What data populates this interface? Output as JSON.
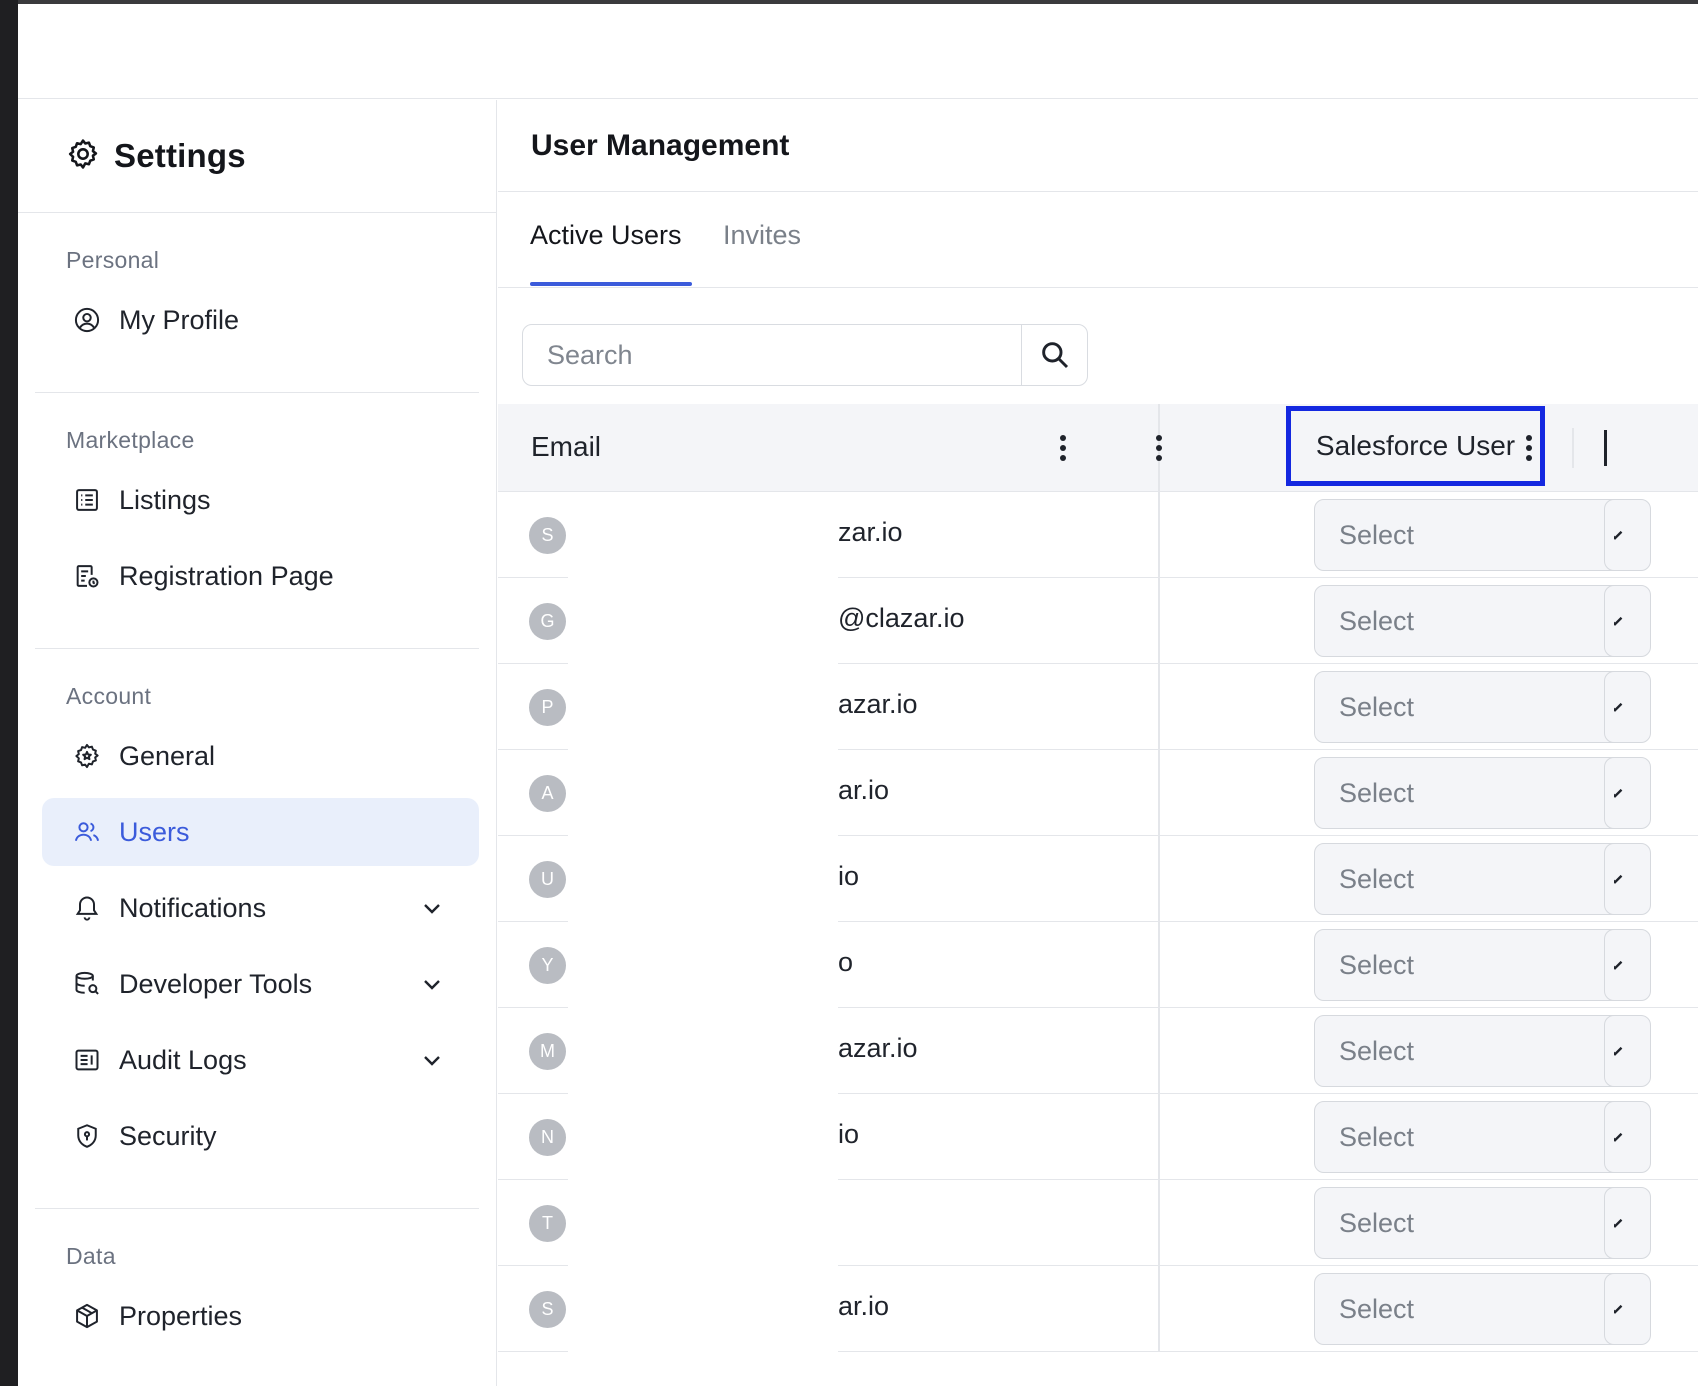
{
  "sidebar": {
    "title": "Settings",
    "sections": [
      {
        "label": "Personal",
        "items": [
          {
            "label": "My Profile",
            "icon": "user-circle-icon"
          }
        ]
      },
      {
        "label": "Marketplace",
        "items": [
          {
            "label": "Listings",
            "icon": "list-icon"
          },
          {
            "label": "Registration Page",
            "icon": "form-icon"
          }
        ]
      },
      {
        "label": "Account",
        "items": [
          {
            "label": "General",
            "icon": "gear-badge-icon"
          },
          {
            "label": "Users",
            "icon": "users-icon",
            "active": true
          },
          {
            "label": "Notifications",
            "icon": "bell-icon",
            "expandable": true
          },
          {
            "label": "Developer Tools",
            "icon": "database-search-icon",
            "expandable": true
          },
          {
            "label": "Audit Logs",
            "icon": "log-icon",
            "expandable": true
          },
          {
            "label": "Security",
            "icon": "shield-icon"
          }
        ]
      },
      {
        "label": "Data",
        "items": [
          {
            "label": "Properties",
            "icon": "cube-icon"
          }
        ]
      }
    ]
  },
  "main": {
    "title": "User Management",
    "tabs": [
      {
        "label": "Active Users",
        "active": true
      },
      {
        "label": "Invites",
        "active": false
      }
    ],
    "search": {
      "placeholder": "Search"
    },
    "table": {
      "headers": {
        "email": "Email",
        "salesforce_user": "Salesforce User"
      },
      "rows": [
        {
          "initial": "S",
          "email": "zar.io",
          "select": "Select"
        },
        {
          "initial": "G",
          "email": "@clazar.io",
          "select": "Select"
        },
        {
          "initial": "P",
          "email": "azar.io",
          "select": "Select"
        },
        {
          "initial": "A",
          "email": "ar.io",
          "select": "Select"
        },
        {
          "initial": "U",
          "email": "io",
          "select": "Select"
        },
        {
          "initial": "Y",
          "email": "o",
          "select": "Select"
        },
        {
          "initial": "M",
          "email": "azar.io",
          "select": "Select"
        },
        {
          "initial": "N",
          "email": "io",
          "select": "Select"
        },
        {
          "initial": "T",
          "email": "",
          "select": "Select"
        },
        {
          "initial": "S",
          "email": "ar.io",
          "select": "Select"
        }
      ]
    }
  },
  "colors": {
    "accent": "#3b5bdb",
    "highlight_box": "#1428e0",
    "active_nav_bg": "#e9effb"
  }
}
